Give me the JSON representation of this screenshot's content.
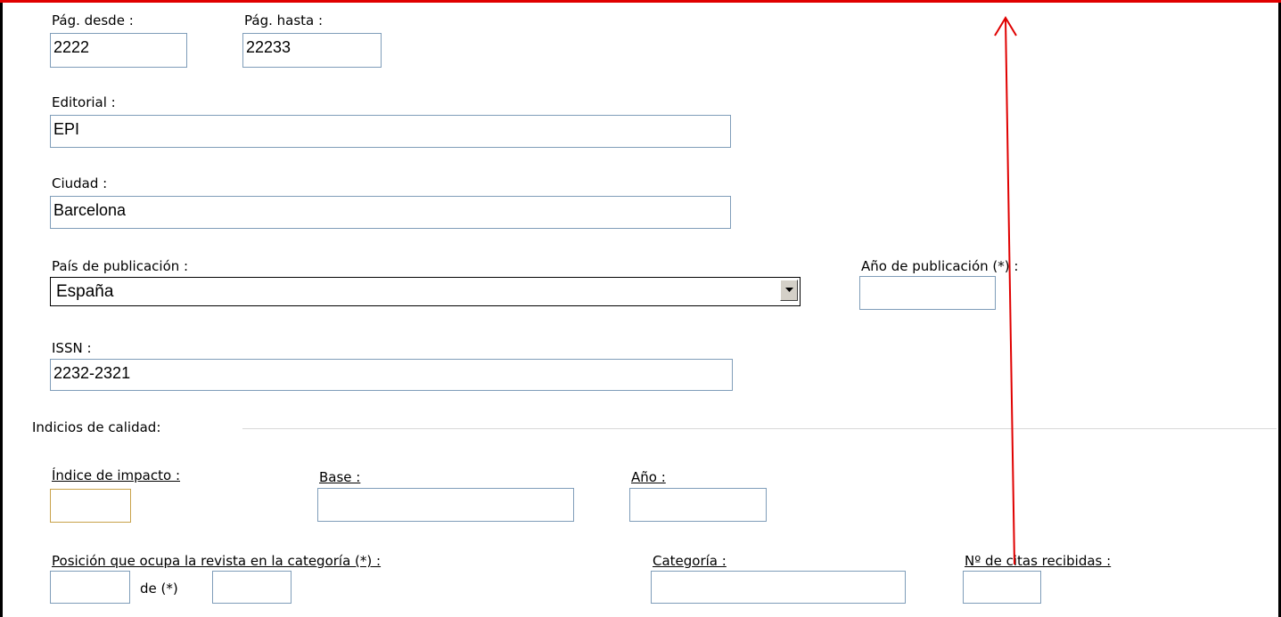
{
  "form": {
    "pag_desde": {
      "label": "Pág. desde :",
      "value": "2222"
    },
    "pag_hasta": {
      "label": "Pág. hasta :",
      "value": "22233"
    },
    "editorial": {
      "label": "Editorial :",
      "value": "EPI"
    },
    "ciudad": {
      "label": "Ciudad :",
      "value": "Barcelona"
    },
    "pais": {
      "label": "País de publicación :",
      "value": "España"
    },
    "anio_pub": {
      "label": "Año de publicación (*) :",
      "value": ""
    },
    "issn": {
      "label": "ISSN :",
      "value": "2232-2321"
    }
  },
  "calidad": {
    "section_label": "Indicios de calidad:",
    "indice": {
      "label": "Índice de impacto :",
      "value": ""
    },
    "base": {
      "label": "Base :",
      "value": ""
    },
    "anio": {
      "label": "Año :",
      "value": ""
    },
    "posicion": {
      "label": "Posición que ocupa la revista en la categoría (*) :",
      "value": "",
      "de_label": "de (*)",
      "de_value": ""
    },
    "categoria": {
      "label": "Categoría :",
      "value": ""
    },
    "citas": {
      "label": "Nº de citas recibidas :",
      "value": ""
    }
  },
  "annotation": {
    "color": "#e00000"
  }
}
